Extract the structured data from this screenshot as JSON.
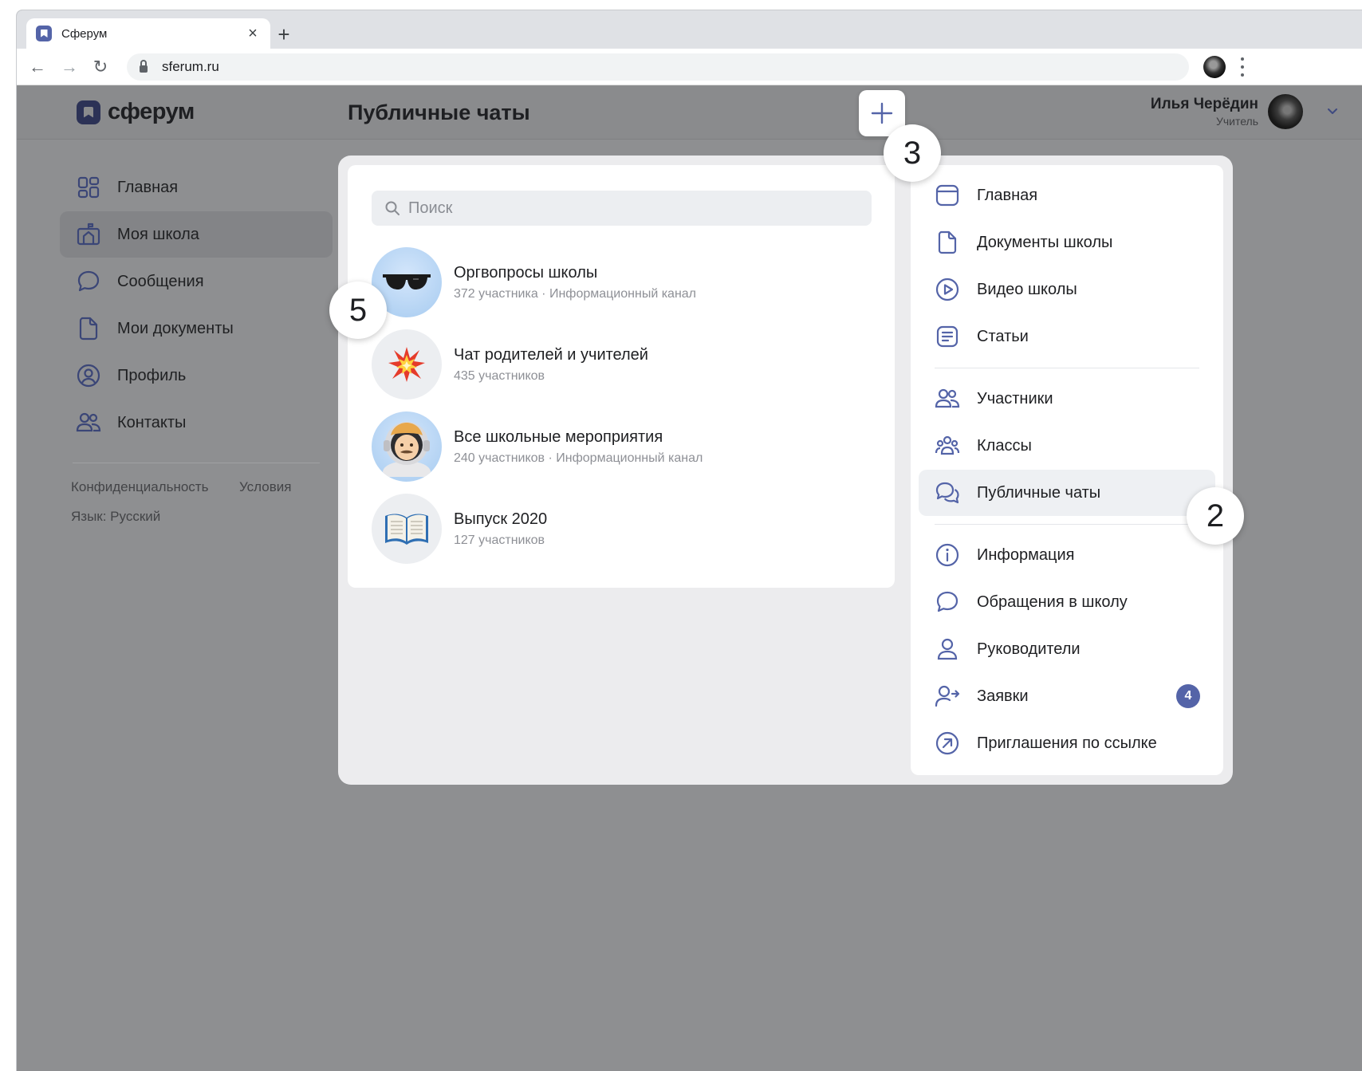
{
  "browser": {
    "tab_title": "Сферум",
    "tab_close": "×",
    "new_tab": "+",
    "url": "sferum.ru",
    "back": "←",
    "forward": "→",
    "reload": "↻"
  },
  "header": {
    "logo_text": "сферум",
    "page_title": "Публичные чаты",
    "user_name": "Илья Черёдин",
    "user_role": "Учитель"
  },
  "sidebar": {
    "items": [
      {
        "label": "Главная",
        "icon": "grid-icon"
      },
      {
        "label": "Моя школа",
        "icon": "school-icon",
        "active": true
      },
      {
        "label": "Сообщения",
        "icon": "message-icon"
      },
      {
        "label": "Мои документы",
        "icon": "document-icon"
      },
      {
        "label": "Профиль",
        "icon": "profile-icon"
      },
      {
        "label": "Контакты",
        "icon": "contacts-icon"
      }
    ],
    "footer": {
      "privacy": "Конфиденциальность",
      "terms": "Условия",
      "language": "Язык: Русский"
    }
  },
  "search": {
    "placeholder": "Поиск"
  },
  "chats": [
    {
      "title": "Оргвопросы школы",
      "subtitle": "372 участника · Информационный канал",
      "avatar": "sunglasses"
    },
    {
      "title": "Чат родителей и учителей",
      "subtitle": "435 участников",
      "avatar": "collision"
    },
    {
      "title": "Все школьные мероприятия",
      "subtitle": "240 участников · Информационный канал",
      "avatar": "astronaut"
    },
    {
      "title": "Выпуск 2020",
      "subtitle": "127 участников",
      "avatar": "open-book"
    }
  ],
  "school_menu": {
    "items": [
      {
        "label": "Главная",
        "icon": "browser-window-icon"
      },
      {
        "label": "Документы школы",
        "icon": "document-icon"
      },
      {
        "label": "Видео школы",
        "icon": "play-icon"
      },
      {
        "label": "Статьи",
        "icon": "article-icon"
      },
      {
        "label": "Участники",
        "icon": "users-icon"
      },
      {
        "label": "Классы",
        "icon": "classes-icon"
      },
      {
        "label": "Публичные чаты",
        "icon": "chats-icon",
        "active": true
      },
      {
        "label": "Информация",
        "icon": "info-icon"
      },
      {
        "label": "Обращения в школу",
        "icon": "message-icon"
      },
      {
        "label": "Руководители",
        "icon": "user-icon"
      },
      {
        "label": "Заявки",
        "icon": "user-arrow-icon",
        "badge": "4"
      },
      {
        "label": "Приглашения по ссылке",
        "icon": "link-arrow-icon"
      }
    ]
  },
  "callouts": [
    "3",
    "5",
    "2"
  ],
  "colors": {
    "accent": "#5464a8",
    "overlay": "#8e8f91",
    "panel": "#ececee"
  }
}
